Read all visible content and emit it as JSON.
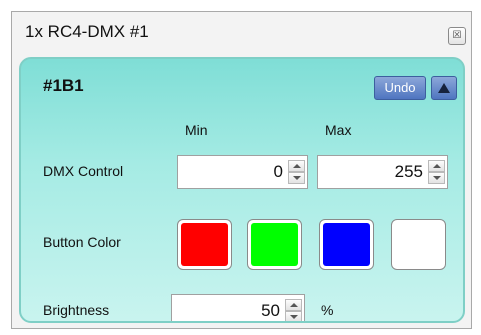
{
  "window": {
    "title": "1x RC4-DMX #1"
  },
  "panel": {
    "title": "#1B1",
    "undo_label": "Undo"
  },
  "dmx_control": {
    "label": "DMX Control",
    "min_header": "Min",
    "max_header": "Max",
    "min_value": "0",
    "max_value": "255"
  },
  "button_color": {
    "label": "Button Color",
    "swatches": [
      {
        "name": "red",
        "color": "#ff0000"
      },
      {
        "name": "green",
        "color": "#00ff00"
      },
      {
        "name": "blue",
        "color": "#0000ff"
      },
      {
        "name": "white",
        "color": "#ffffff"
      }
    ]
  },
  "brightness": {
    "label": "Brightness",
    "value": "50",
    "unit": "%"
  },
  "colors": {
    "panel_accent": "#7fded6",
    "button_blue": "#4f75c0"
  }
}
